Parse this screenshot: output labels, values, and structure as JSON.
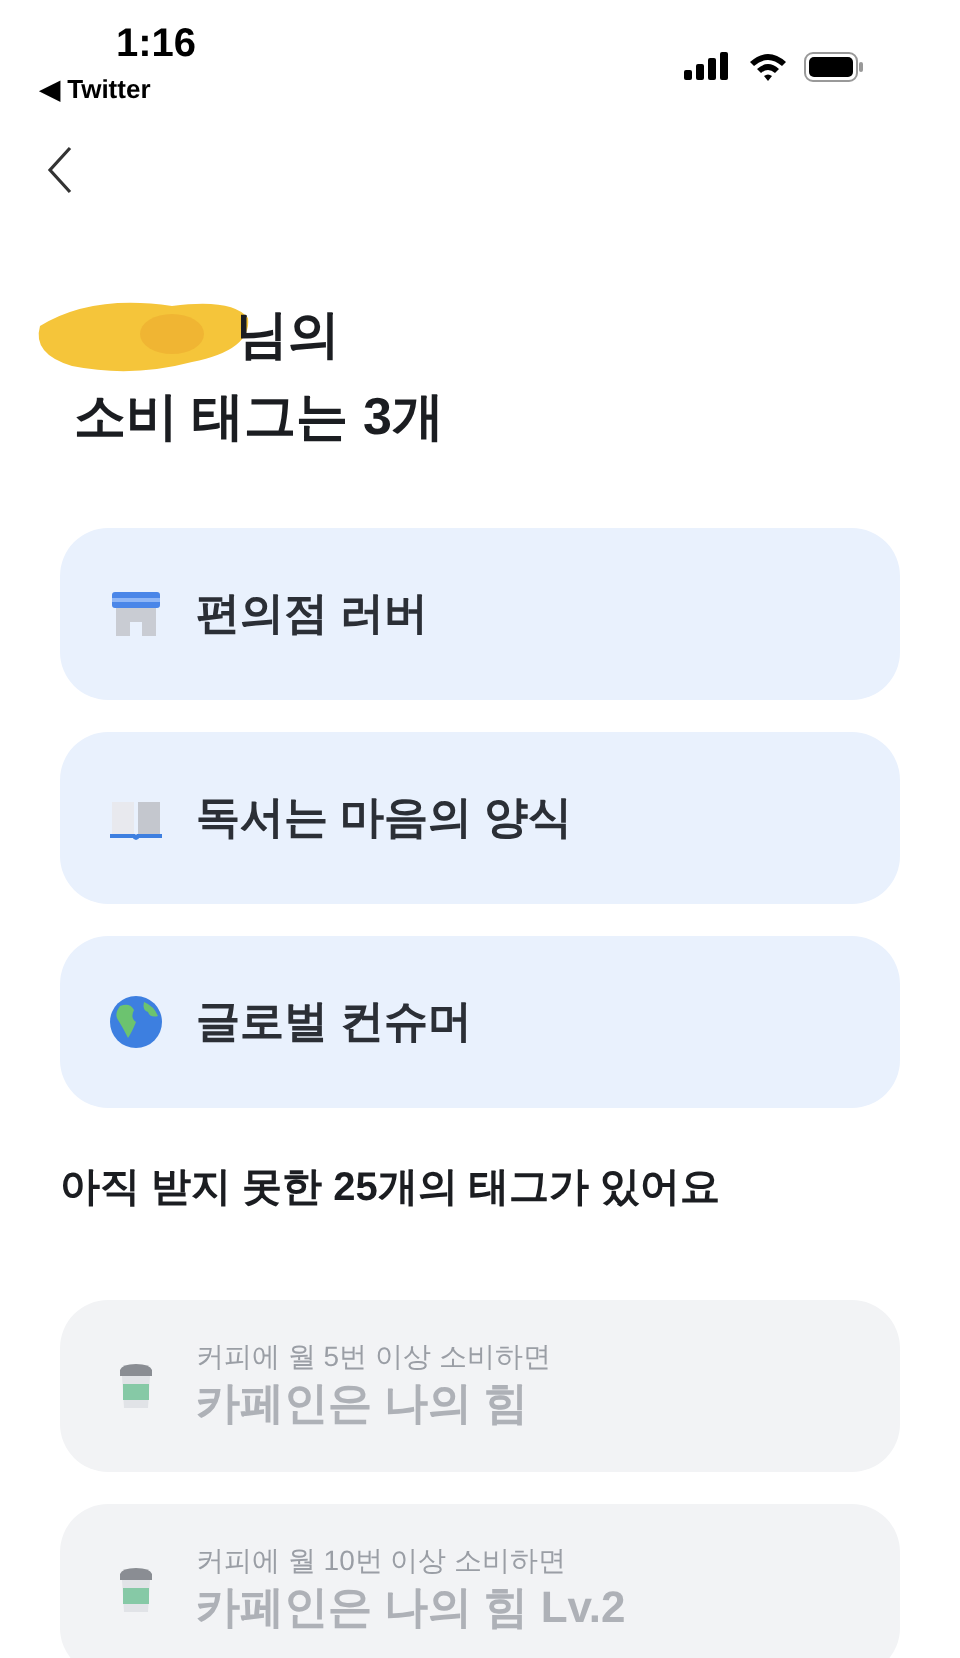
{
  "status_bar": {
    "time": "1:16",
    "back_app": "◀ Twitter"
  },
  "title_lines": [
    "님의",
    "소비 태그는 3개"
  ],
  "earned_tags": [
    {
      "kind": "store",
      "label": "편의점 러버"
    },
    {
      "kind": "book",
      "label": "독서는 마음의 양식"
    },
    {
      "kind": "globe",
      "label": "글로벌 컨슈머"
    }
  ],
  "locked_heading": "아직 받지 못한 25개의 태그가 있어요",
  "locked_tags": [
    {
      "kind": "cup",
      "condition": "커피에 월 5번 이상 소비하면",
      "label": "카페인은 나의 힘"
    },
    {
      "kind": "cup",
      "condition": "커피에 월 10번 이상 소비하면",
      "label": "카페인은 나의 힘 Lv.2"
    }
  ]
}
